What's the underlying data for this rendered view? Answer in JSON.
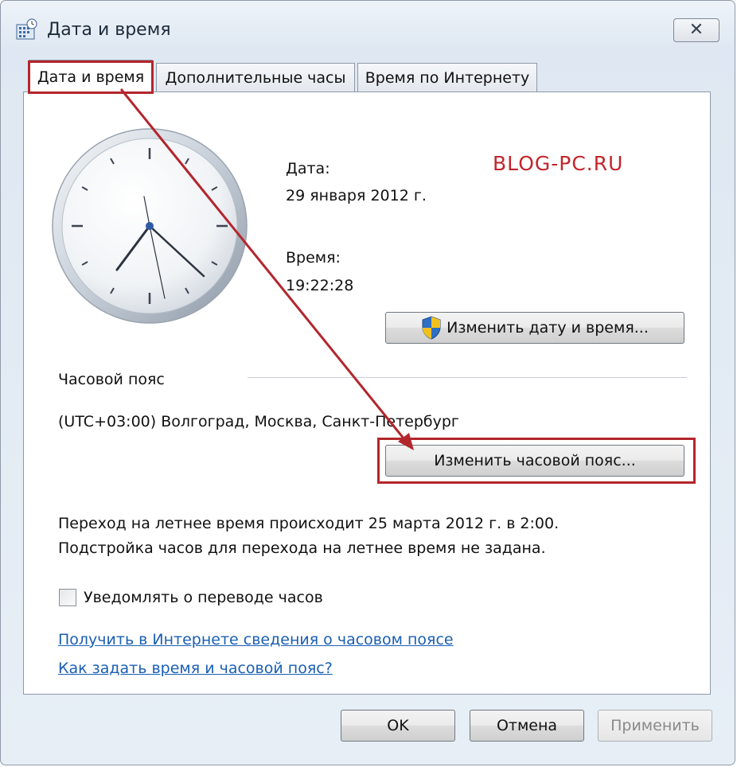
{
  "window": {
    "title": "Дата и время",
    "close_glyph": "✕"
  },
  "tabs": [
    {
      "label": "Дата и время",
      "active": true
    },
    {
      "label": "Дополнительные часы",
      "active": false
    },
    {
      "label": "Время по Интернету",
      "active": false
    }
  ],
  "watermark": "BLOG-PC.RU",
  "date": {
    "label": "Дата:",
    "value": "29 января 2012 г."
  },
  "time": {
    "label": "Время:",
    "value": "19:22:28"
  },
  "buttons": {
    "change_datetime": "Изменить дату и время...",
    "change_timezone": "Изменить часовой пояс...",
    "ok": "OK",
    "cancel": "Отмена",
    "apply": "Применить"
  },
  "timezone": {
    "heading": "Часовой пояс",
    "value": "(UTC+03:00) Волгоград, Москва, Санкт-Петербург"
  },
  "dst": {
    "line1": "Переход на летнее время происходит 25 марта 2012 г. в 2:00.",
    "line2": "Подстройка часов для перехода на летнее время не задана."
  },
  "notify_checkbox": {
    "label": "Уведомлять о переводе часов",
    "checked": false
  },
  "links": {
    "tz_info": "Получить в Интернете сведения о часовом поясе",
    "how_to": "Как задать время и часовой пояс?"
  },
  "colors": {
    "highlight": "#b3262c",
    "link": "#1a5fb4"
  },
  "icons": {
    "app": "calendar-clock-icon",
    "shield": "uac-shield-icon",
    "close": "close-icon"
  }
}
